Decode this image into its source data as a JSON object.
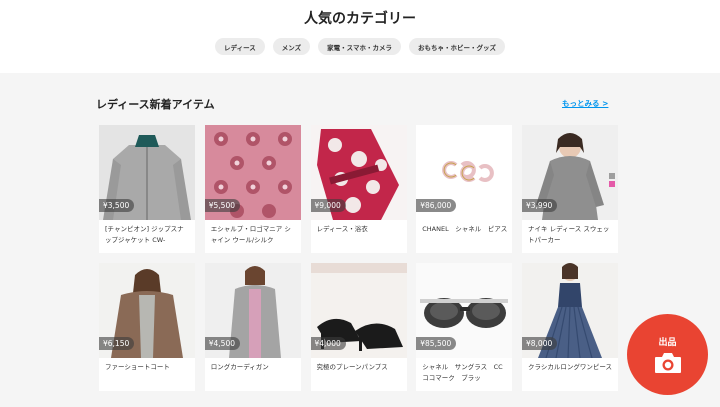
{
  "categories": {
    "title": "人気のカテゴリー",
    "chips": [
      "レディース",
      "メンズ",
      "家電・スマホ・カメラ",
      "おもちゃ・ホビー・グッズ"
    ]
  },
  "section": {
    "title": "レディース新着アイテム",
    "more": "もっとみる >"
  },
  "items": [
    {
      "price": "¥3,500",
      "name": "[チャンピオン] ジップスナップジャケット CW-",
      "icon": "gray-fleece-jacket"
    },
    {
      "price": "¥5,500",
      "name": "エシャルプ・ロゴマニア シャイン ウール/シルク",
      "icon": "pink-monogram-scarf"
    },
    {
      "price": "¥9,000",
      "name": "レディース・浴衣",
      "icon": "floral-yukata"
    },
    {
      "price": "¥86,000",
      "name": "CHANEL　シャネル　ピアス",
      "icon": "cc-earrings"
    },
    {
      "price": "¥3,990",
      "name": "ナイキ レディース スウェットパーカー",
      "icon": "gray-hoodie"
    },
    {
      "price": "¥6,150",
      "name": "ファーショートコート",
      "icon": "fur-coat"
    },
    {
      "price": "¥4,500",
      "name": "ロングカーディガン",
      "icon": "long-cardigan"
    },
    {
      "price": "¥4,000",
      "name": "究極のプレーンパンプス",
      "icon": "black-pumps"
    },
    {
      "price": "¥85,500",
      "name": "シャネル　サングラス　CC　ココマーク　ブラッ",
      "icon": "sunglasses"
    },
    {
      "price": "¥8,000",
      "name": "クラシカルロングワンピース",
      "icon": "navy-pleated-dress"
    }
  ],
  "fab": {
    "label": "出品",
    "icon": "camera-icon"
  },
  "colors": {
    "accent": "#e94432",
    "link": "#0095ee"
  }
}
